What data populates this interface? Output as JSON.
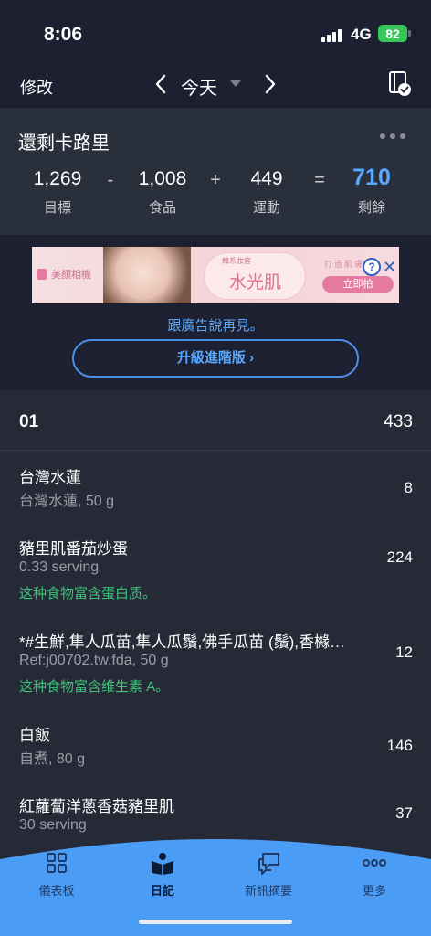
{
  "status": {
    "time": "8:06",
    "network": "4G",
    "battery": "82"
  },
  "nav": {
    "edit": "修改",
    "date": "今天"
  },
  "calories": {
    "title": "還剩卡路里",
    "goal": "1,269",
    "goal_label": "目標",
    "minus": "-",
    "food": "1,008",
    "food_label": "食品",
    "plus": "+",
    "exercise": "449",
    "exercise_label": "運動",
    "equals": "=",
    "remaining": "710",
    "remaining_label": "剩餘"
  },
  "ad": {
    "brand": "美顏相機",
    "circle_top": "韓系妝容",
    "headline": "水光肌",
    "sub": "打造肌膚光",
    "cta": "立即拍",
    "info": "?",
    "close": "✕",
    "remove_text": "跟廣告說再見。",
    "upgrade": "升級進階版 ›"
  },
  "meal": {
    "name": "01",
    "total": "433"
  },
  "foods": [
    {
      "name": "台灣水蓮",
      "detail": "台灣水蓮, 50 g",
      "note": "",
      "calories": "8"
    },
    {
      "name": "豬里肌番茄炒蛋",
      "detail": "0.33 serving",
      "note": "这种食物富含蛋白质。",
      "calories": "224"
    },
    {
      "name": "*#生鮮,隼人瓜苗,隼人瓜鬚,佛手瓜苗 (鬚),香櫞…",
      "detail": "Ref:j00702.tw.fda, 50 g",
      "note": "这种食物富含维生素 A。",
      "calories": "12"
    },
    {
      "name": "白飯",
      "detail": "自煮, 80 g",
      "note": "",
      "calories": "146"
    },
    {
      "name": "紅蘿蔔洋蔥香菇豬里肌",
      "detail": "30 serving",
      "note": "",
      "calories": "37"
    }
  ],
  "tabs": [
    {
      "label": "儀表板",
      "icon": "dashboard-icon"
    },
    {
      "label": "日記",
      "icon": "diary-icon"
    },
    {
      "label": "新訊摘要",
      "icon": "news-icon"
    },
    {
      "label": "更多",
      "icon": "more-icon"
    }
  ],
  "colors": {
    "accent": "#5aa8ff",
    "note_green": "#3ec37a",
    "tabbar": "#4b9cf5",
    "background": "#262a36"
  }
}
